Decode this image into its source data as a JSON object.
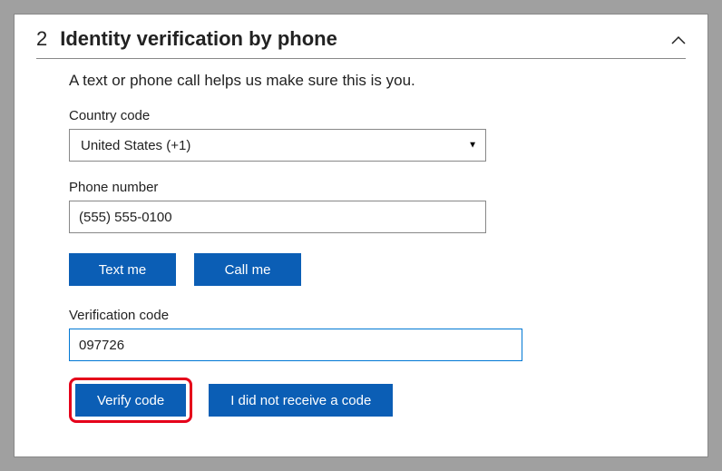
{
  "step": {
    "number": "2",
    "title": "Identity verification by phone"
  },
  "subtitle": "A text or phone call helps us make sure this is you.",
  "country": {
    "label": "Country code",
    "value": "United States (+1)"
  },
  "phone": {
    "label": "Phone number",
    "value": "(555) 555-0100"
  },
  "buttons": {
    "text_me": "Text me",
    "call_me": "Call me",
    "verify": "Verify code",
    "not_received": "I did not receive a code"
  },
  "verification": {
    "label": "Verification code",
    "value": "097726"
  },
  "colors": {
    "primary": "#0b5eb5",
    "highlight": "#e5001a",
    "focus": "#0078d4"
  }
}
